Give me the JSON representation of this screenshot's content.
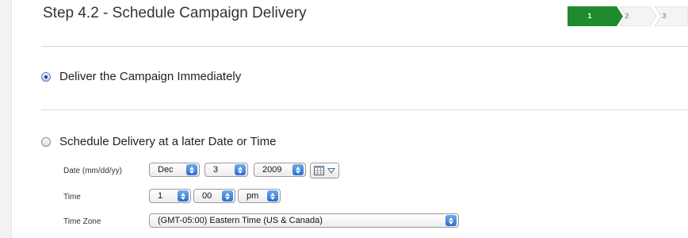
{
  "page": {
    "title": "Step 4.2 - Schedule Campaign Delivery"
  },
  "steps": [
    "1",
    "2",
    "3"
  ],
  "current_step": "1",
  "colors": {
    "active_step": "#1f8a2e",
    "inactive_step": "#f4f4f4",
    "stepper": "#2e6fd0"
  },
  "delivery": {
    "immediate_label": "Deliver the Campaign Immediately",
    "immediate_selected": true,
    "scheduled_label": "Schedule Delivery at a later Date or Time",
    "scheduled_selected": false
  },
  "schedule": {
    "date_label": "Date (mm/dd/yy)",
    "month": "Dec",
    "day": "3",
    "year": "2009",
    "time_label": "Time",
    "hour": "1",
    "minute": "00",
    "ampm": "pm",
    "timezone_label": "Time Zone",
    "timezone": "(GMT-05:00) Eastern Time (US & Canada)"
  },
  "icons": {
    "calendar": "calendar-icon",
    "dropdown": "triangle-down-icon"
  }
}
